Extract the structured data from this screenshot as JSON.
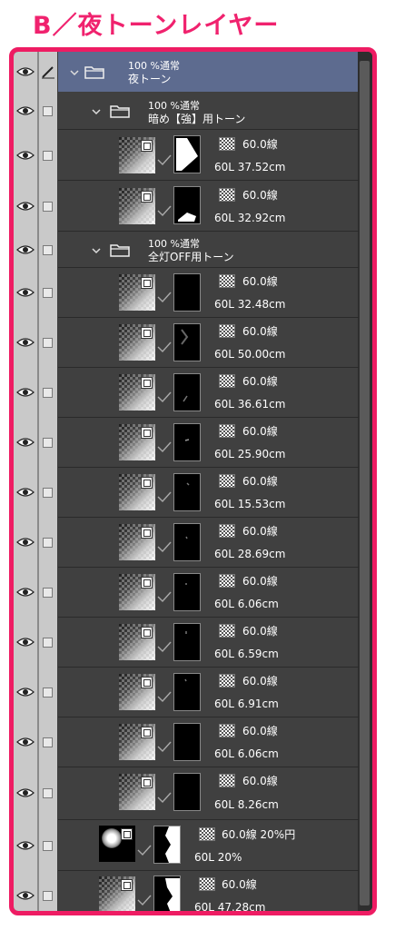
{
  "title": "B／夜トーンレイヤー",
  "root_folder": {
    "line1": "100 %通常",
    "line2": "夜トーン"
  },
  "folder_dark": {
    "line1": "100 %通常",
    "line2": "暗め【強】用トーン"
  },
  "folder_lights_off": {
    "line1": "100 %通常",
    "line2": "全灯OFF用トーン"
  },
  "dark_layers": [
    {
      "tone": "60.0線",
      "detail": "60L 37.52cm"
    },
    {
      "tone": "60.0線",
      "detail": "60L 32.92cm"
    }
  ],
  "lights_off_layers": [
    {
      "tone": "60.0線",
      "detail": "60L 32.48cm"
    },
    {
      "tone": "60.0線",
      "detail": "60L 50.00cm"
    },
    {
      "tone": "60.0線",
      "detail": "60L 36.61cm"
    },
    {
      "tone": "60.0線",
      "detail": "60L 25.90cm"
    },
    {
      "tone": "60.0線",
      "detail": "60L 15.53cm"
    },
    {
      "tone": "60.0線",
      "detail": "60L 28.69cm"
    },
    {
      "tone": "60.0線",
      "detail": "60L 6.06cm"
    },
    {
      "tone": "60.0線",
      "detail": "60L 6.59cm"
    },
    {
      "tone": "60.0線",
      "detail": "60L 6.91cm"
    },
    {
      "tone": "60.0線",
      "detail": "60L 6.06cm"
    },
    {
      "tone": "60.0線",
      "detail": "60L 8.26cm"
    }
  ],
  "bottom_layers": [
    {
      "tone": "60.0線 20%円",
      "detail": "60L 20%"
    },
    {
      "tone": "60.0線",
      "detail": "60L 47.28cm"
    }
  ],
  "colors": {
    "title": "#f0226e",
    "frame": "#ee1c63",
    "selected_row": "#5d6b8f",
    "panel": "#404040"
  }
}
